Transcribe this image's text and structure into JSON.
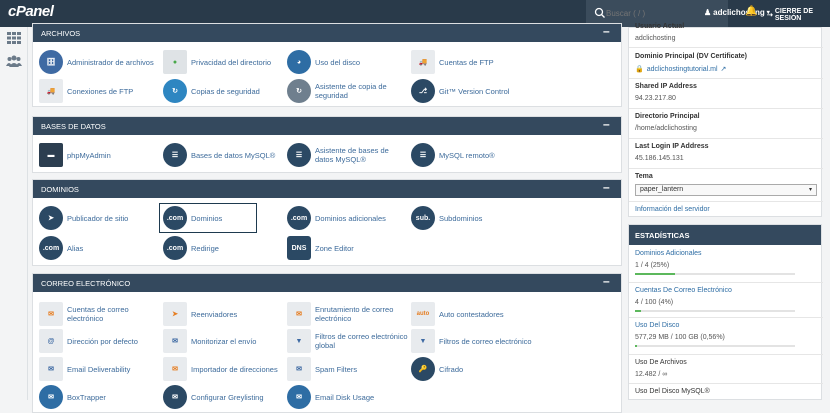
{
  "topbar": {
    "logo": "cPanel",
    "search_placeholder": "Buscar ( / )",
    "user": "adclichosting",
    "logout": "CIERRE DE SESIÓN"
  },
  "panels": {
    "archivos": {
      "title": "ARCHIVOS",
      "items": [
        {
          "label": "Administrador de archivos",
          "icon": "file-manager-icon"
        },
        {
          "label": "Privacidad del directorio",
          "icon": "directory-privacy-icon"
        },
        {
          "label": "Uso del disco",
          "icon": "disk-usage-icon"
        },
        {
          "label": "Cuentas de FTP",
          "icon": "ftp-accounts-icon"
        },
        {
          "label": "Conexiones de FTP",
          "icon": "ftp-connections-icon"
        },
        {
          "label": "Copias de seguridad",
          "icon": "backup-icon"
        },
        {
          "label": "Asistente de copia de seguridad",
          "icon": "backup-wizard-icon"
        },
        {
          "label": "Git™ Version Control",
          "icon": "git-icon"
        }
      ]
    },
    "bases": {
      "title": "BASES DE DATOS",
      "items": [
        {
          "label": "phpMyAdmin",
          "icon": "phpmyadmin-icon"
        },
        {
          "label": "Bases de datos MySQL®",
          "icon": "mysql-databases-icon"
        },
        {
          "label": "Asistente de bases de datos MySQL®",
          "icon": "mysql-wizard-icon"
        },
        {
          "label": "MySQL remoto®",
          "icon": "remote-mysql-icon"
        }
      ]
    },
    "dominios": {
      "title": "DOMINIOS",
      "items": [
        {
          "label": "Publicador de sitio",
          "icon": "site-publisher-icon"
        },
        {
          "label": "Dominios",
          "icon": "domains-icon",
          "badge": ".com"
        },
        {
          "label": "Dominios adicionales",
          "icon": "addon-domains-icon",
          "badge": ".com"
        },
        {
          "label": "Subdominios",
          "icon": "subdomains-icon",
          "badge": "sub."
        },
        {
          "label": "Alias",
          "icon": "aliases-icon",
          "badge": ".com"
        },
        {
          "label": "Redirige",
          "icon": "redirects-icon",
          "badge": ".com"
        },
        {
          "label": "Zone Editor",
          "icon": "zone-editor-icon",
          "badge": "DNS"
        }
      ]
    },
    "correo": {
      "title": "CORREO ELECTRÓNICO",
      "items": [
        {
          "label": "Cuentas de correo electrónico",
          "icon": "email-accounts-icon"
        },
        {
          "label": "Reenviadores",
          "icon": "forwarders-icon"
        },
        {
          "label": "Enrutamiento de correo electrónico",
          "icon": "email-routing-icon"
        },
        {
          "label": "Auto contestadores",
          "icon": "autoresponders-icon",
          "badge": "auto"
        },
        {
          "label": "Dirección por defecto",
          "icon": "default-address-icon"
        },
        {
          "label": "Monitorizar el envío",
          "icon": "track-delivery-icon"
        },
        {
          "label": "Filtros de correo electrónico global",
          "icon": "global-filters-icon"
        },
        {
          "label": "Filtros de correo electrónico",
          "icon": "email-filters-icon"
        },
        {
          "label": "Email Deliverability",
          "icon": "email-deliverability-icon"
        },
        {
          "label": "Importador de direcciones",
          "icon": "address-importer-icon"
        },
        {
          "label": "Spam Filters",
          "icon": "spam-filters-icon"
        },
        {
          "label": "Cifrado",
          "icon": "encryption-icon"
        },
        {
          "label": "BoxTrapper",
          "icon": "boxtrapper-icon"
        },
        {
          "label": "Configurar Greylisting",
          "icon": "greylisting-icon"
        },
        {
          "label": "Email Disk Usage",
          "icon": "email-disk-usage-icon"
        }
      ]
    }
  },
  "info": {
    "user_label": "Usuario Actual",
    "user_value": "adclichosting",
    "domain_label": "Dominio Principal (DV Certificate)",
    "domain_value": "adclichostingtutorial.ml",
    "shared_ip_label": "Shared IP Address",
    "shared_ip_value": "94.23.217.80",
    "dir_label": "Directorio Principal",
    "dir_value": "/home/adclichosting",
    "last_ip_label": "Last Login IP Address",
    "last_ip_value": "45.186.145.131",
    "theme_label": "Tema",
    "theme_value": "paper_lantern",
    "server_info": "Información del servidor"
  },
  "stats": {
    "title": "ESTADÍSTICAS",
    "rows": [
      {
        "label": "Dominios Adicionales",
        "value": "1 / 4   (25%)",
        "fraction": 0.25
      },
      {
        "label": "Cuentas De Correo Electrónico",
        "value": "4 / 100   (4%)",
        "fraction": 0.04
      },
      {
        "label": "Uso Del Disco",
        "value": "577,29 MB / 100 GB   (0,56%)",
        "fraction": 0.0056
      },
      {
        "label": "Uso De Archivos",
        "value": "12.482 / ∞",
        "fraction": null
      },
      {
        "label": "Uso Del Disco MySQL®",
        "value": "",
        "fraction": null
      }
    ]
  }
}
